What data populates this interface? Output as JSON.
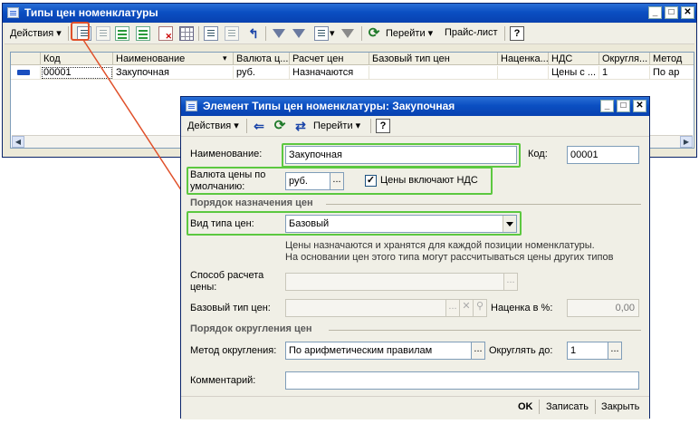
{
  "main_window": {
    "title": "Типы цен номенклатуры",
    "toolbar": {
      "actions_label": "Действия",
      "goto_label": "Перейти",
      "pricelist_label": "Прайс-лист",
      "help_label": "?"
    },
    "columns": [
      "Код",
      "Наименование",
      "Валюта ц...",
      "Расчет цен",
      "Базовый тип цен",
      "Наценка...",
      "НДС",
      "Округля...",
      "Метод"
    ],
    "rows": [
      {
        "code": "00001",
        "name": "Закупочная",
        "currency": "руб.",
        "calc": "Назначаются",
        "base_type": "",
        "markup": "",
        "vat": "Цены с ...",
        "rounding": "1",
        "method": "По ар"
      }
    ]
  },
  "dialog": {
    "title": "Элемент Типы цен номенклатуры: Закупочная",
    "toolbar": {
      "actions_label": "Действия",
      "goto_label": "Перейти",
      "help_label": "?"
    },
    "name_label": "Наименование:",
    "name_value": "Закупочная",
    "code_label": "Код:",
    "code_value": "00001",
    "currency_label_1": "Валюта цены по",
    "currency_label_2": "умолчанию:",
    "currency_value": "руб.",
    "vat_checkbox_label": "Цены включают НДС",
    "vat_checked": true,
    "section_assign": "Порядок назначения цен",
    "price_type_label": "Вид типа цен:",
    "price_type_value": "Базовый",
    "info_line_1": "Цены назначаются и хранятся для каждой позиции номенклатуры.",
    "info_line_2": "На основании цен этого типа могут рассчитываться цены других типов",
    "calc_method_label_1": "Способ расчета",
    "calc_method_label_2": "цены:",
    "base_type_label": "Базовый тип цен:",
    "markup_label": "Наценка в %:",
    "markup_value": "0,00",
    "section_rounding": "Порядок округления цен",
    "rounding_method_label": "Метод округления:",
    "rounding_method_value": "По арифметическим правилам",
    "round_to_label": "Округлять до:",
    "round_to_value": "1",
    "comment_label": "Комментарий:",
    "comment_value": "",
    "buttons": {
      "ok": "OK",
      "save": "Записать",
      "close": "Закрыть"
    },
    "ellipsis": "..."
  },
  "colors": {
    "highlight_green": "#5cc840",
    "annotation_red": "#e0502a",
    "title_blue": "#0b4fc2"
  }
}
